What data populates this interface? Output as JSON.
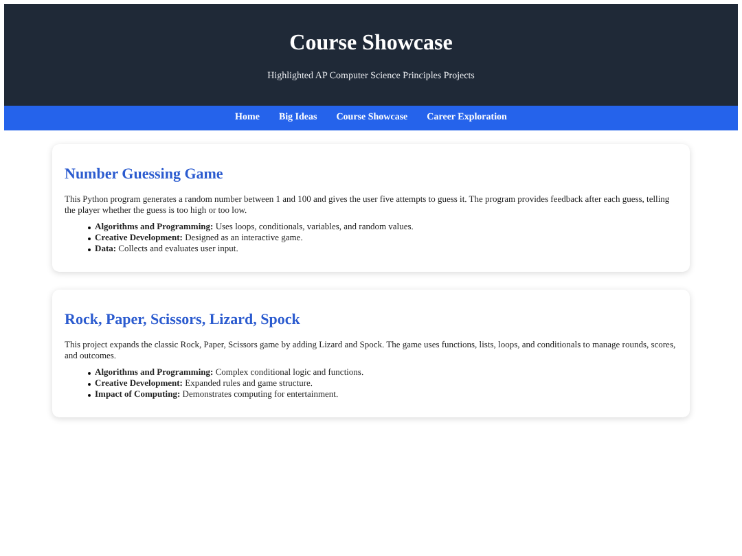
{
  "header": {
    "title": "Course Showcase",
    "subtitle": "Highlighted AP Computer Science Principles Projects"
  },
  "nav": [
    "Home",
    "Big Ideas",
    "Course Showcase",
    "Career Exploration"
  ],
  "projects": [
    {
      "title": "Number Guessing Game",
      "description": "This Python program generates a random number between 1 and 100 and gives the user five attempts to guess it. The program provides feedback after each guess, telling the player whether the guess is too high or too low.",
      "points": [
        "**Algorithms and Programming:** Uses loops, conditionals, variables, and random values.",
        "**Creative Development:** Designed as an interactive game.",
        "**Data:** Collects and evaluates user input."
      ]
    },
    {
      "title": "Rock, Paper, Scissors, Lizard, Spock",
      "description": "This project expands the classic Rock, Paper, Scissors game by adding Lizard and Spock. The game uses functions, lists, loops, and conditionals to manage rounds, scores, and outcomes.",
      "points": [
        "**Algorithms and Programming:** Complex conditional logic and functions.",
        "**Creative Development:** Expanded rules and game structure.",
        "**Impact of Computing:** Demonstrates computing for entertainment."
      ]
    }
  ]
}
